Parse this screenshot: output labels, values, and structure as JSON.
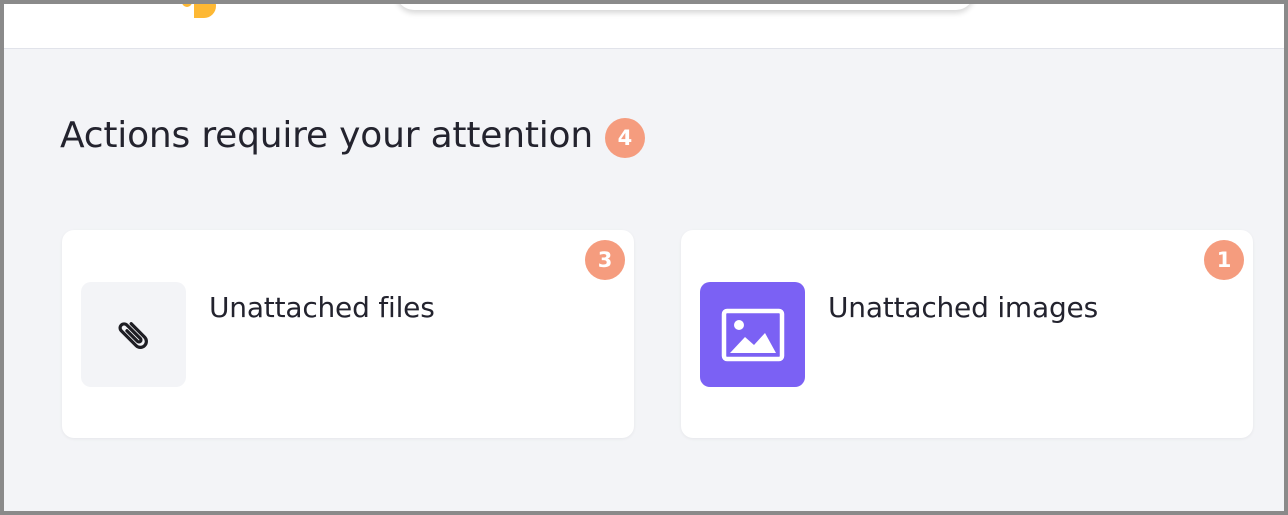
{
  "colors": {
    "badge": "#f59c7e",
    "files_tile": "#f3f4f7",
    "images_tile": "#7b61f4",
    "text": "#23232e",
    "logo": "#fdb834"
  },
  "header": {
    "logo_icon": "logo-mark-icon"
  },
  "section": {
    "title": "Actions require your attention",
    "count": "4"
  },
  "cards": [
    {
      "title": "Unattached files",
      "count": "3",
      "icon": "paperclip-icon"
    },
    {
      "title": "Unattached images",
      "count": "1",
      "icon": "image-icon"
    }
  ]
}
